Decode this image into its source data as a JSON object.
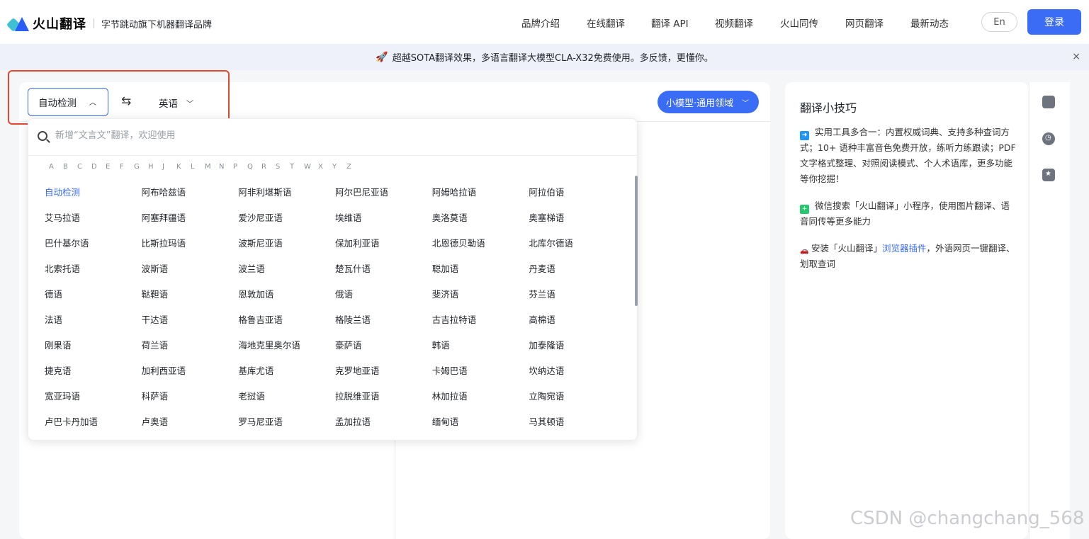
{
  "header": {
    "brand_name": "火山翻译",
    "slogan": "字节跳动旗下机器翻译品牌",
    "nav": [
      "品牌介绍",
      "在线翻译",
      "翻译 API",
      "视频翻译",
      "火山同传",
      "网页翻译",
      "最新动态"
    ],
    "lang_toggle": "En",
    "login_label": "登录"
  },
  "banner": {
    "text": "超越SOTA翻译效果，多语言翻译大模型CLA-X32免费使用。多反馈，更懂你。",
    "icon": "rocket-icon",
    "close": "×"
  },
  "translator": {
    "source_language": "自动检测",
    "target_language": "英语",
    "model_label": "小模型·通用领域",
    "swap_glyph": "⇆"
  },
  "dropdown": {
    "search_placeholder": "新增“文言文”翻译，欢迎使用",
    "alphabet": [
      "A",
      "B",
      "C",
      "D",
      "E",
      "F",
      "G",
      "H",
      "J",
      "K",
      "L",
      "M",
      "N",
      "P",
      "Q",
      "R",
      "S",
      "T",
      "W",
      "X",
      "Y",
      "Z"
    ],
    "languages": [
      [
        "自动检测",
        "阿布哈兹语",
        "阿非利堪斯语",
        "阿尔巴尼亚语",
        "阿姆哈拉语",
        "阿拉伯语"
      ],
      [
        "艾马拉语",
        "阿塞拜疆语",
        "爱沙尼亚语",
        "埃维语",
        "奥洛莫语",
        "奥塞梯语"
      ],
      [
        "巴什基尔语",
        "比斯拉玛语",
        "波斯尼亚语",
        "保加利亚语",
        "北恩德贝勒语",
        "北库尔德语"
      ],
      [
        "北索托语",
        "波斯语",
        "波兰语",
        "楚瓦什语",
        "聪加语",
        "丹麦语"
      ],
      [
        "德语",
        "鞑靼语",
        "恩敦加语",
        "俄语",
        "斐济语",
        "芬兰语"
      ],
      [
        "法语",
        "干达语",
        "格鲁吉亚语",
        "格陵兰语",
        "古吉拉特语",
        "高棉语"
      ],
      [
        "刚果语",
        "荷兰语",
        "海地克里奥尔语",
        "豪萨语",
        "韩语",
        "加泰隆语"
      ],
      [
        "捷克语",
        "加利西亚语",
        "基库尤语",
        "克罗地亚语",
        "卡姆巴语",
        "坎纳达语"
      ],
      [
        "宽亚玛语",
        "科萨语",
        "老挝语",
        "拉脱维亚语",
        "林加拉语",
        "立陶宛语"
      ],
      [
        "卢巴卡丹加语",
        "卢奥语",
        "罗马尼亚语",
        "孟加拉语",
        "缅甸语",
        "马其顿语"
      ]
    ],
    "active_language": "自动检测"
  },
  "tips": {
    "title": "翻译小技巧",
    "items": [
      {
        "icon": "arrow-right-icon",
        "text": "实用工具多合一：内置权威词典、支持多种查词方式；10+ 语种丰富音色免费开放，练听力练跟读；PDF文字格式整理、对照阅读模式、个人术语库，更多功能等你挖掘！"
      },
      {
        "icon": "plus-icon",
        "text": "微信搜索「火山翻译」小程序，使用图片翻译、语音同传等更多能力"
      },
      {
        "icon": "car-icon",
        "text_before": "安装「火山翻译」",
        "link": "浏览器插件",
        "text_after": "，外语网页一键翻译、划取查词"
      }
    ]
  },
  "side_rail": [
    "book-icon",
    "clock-icon",
    "star-icon"
  ],
  "watermark": "CSDN @changchang_568",
  "colors": {
    "accent": "#3b6cf6",
    "highlight_box": "#e1492f",
    "banner_bg": "#eef1f9"
  }
}
